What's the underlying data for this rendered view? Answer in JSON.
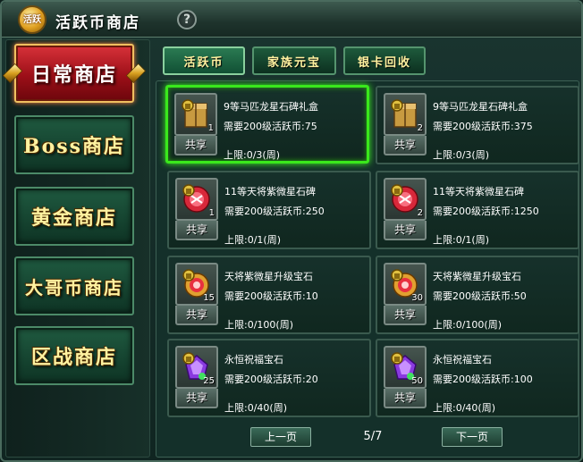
{
  "window": {
    "title": "活跃币商店",
    "logo_text": "活跃",
    "help_label": "?"
  },
  "sidebar": {
    "items": [
      {
        "label": "日常商店",
        "active": true
      },
      {
        "label": "Boss商店",
        "active": false
      },
      {
        "label": "黄金商店",
        "active": false
      },
      {
        "label": "大哥币商店",
        "active": false
      },
      {
        "label": "区战商店",
        "active": false
      }
    ]
  },
  "tabs": [
    {
      "label": "活跃币",
      "active": true
    },
    {
      "label": "家族元宝",
      "active": false
    },
    {
      "label": "银卡回收",
      "active": false
    }
  ],
  "items": [
    {
      "name": "9等马匹龙星石碑礼盒",
      "price": "需要200级活跃币:75",
      "limit": "上限:0/3(周)",
      "qty": "1",
      "share": "共享",
      "icon": "box-icon",
      "selected": true
    },
    {
      "name": "9等马匹龙星石碑礼盒",
      "price": "需要200级活跃币:375",
      "limit": "上限:0/3(周)",
      "qty": "2",
      "share": "共享",
      "icon": "box-icon",
      "selected": false
    },
    {
      "name": "11等天将紫微星石碑",
      "price": "需要200级活跃币:250",
      "limit": "上限:0/1(周)",
      "qty": "1",
      "share": "共享",
      "icon": "stone-tablet-icon",
      "selected": false
    },
    {
      "name": "11等天将紫微星石碑",
      "price": "需要200级活跃币:1250",
      "limit": "上限:0/1(周)",
      "qty": "2",
      "share": "共享",
      "icon": "stone-tablet-icon",
      "selected": false
    },
    {
      "name": "天将紫微星升级宝石",
      "price": "需要200级活跃币:10",
      "limit": "上限:0/100(周)",
      "qty": "15",
      "share": "共享",
      "icon": "upgrade-gem-icon",
      "selected": false
    },
    {
      "name": "天将紫微星升级宝石",
      "price": "需要200级活跃币:50",
      "limit": "上限:0/100(周)",
      "qty": "30",
      "share": "共享",
      "icon": "upgrade-gem-icon",
      "selected": false
    },
    {
      "name": "永恒祝福宝石",
      "price": "需要200级活跃币:20",
      "limit": "上限:0/40(周)",
      "qty": "25",
      "share": "共享",
      "icon": "blessing-gem-icon",
      "selected": false
    },
    {
      "name": "永恒祝福宝石",
      "price": "需要200级活跃币:100",
      "limit": "上限:0/40(周)",
      "qty": "50",
      "share": "共享",
      "icon": "blessing-gem-icon",
      "selected": false
    }
  ],
  "pagination": {
    "prev_label": "上一页",
    "next_label": "下一页",
    "page": "5/7"
  },
  "colors": {
    "accent_green": "#3ae81c",
    "active_red": "#c8202a",
    "label_gold": "#fff2a0"
  }
}
